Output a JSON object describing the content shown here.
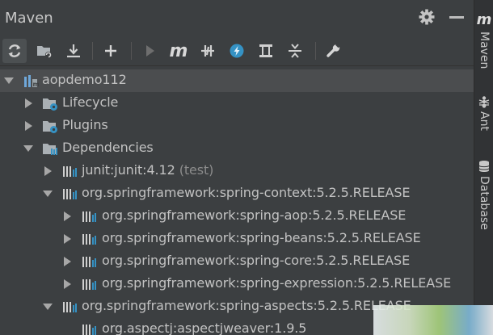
{
  "panel": {
    "title": "Maven"
  },
  "toolbar": {
    "buttons": [
      {
        "name": "refresh"
      },
      {
        "name": "reimport-folder"
      },
      {
        "name": "download-sources"
      },
      {
        "name": "add"
      },
      {
        "name": "run"
      },
      {
        "name": "execute-goal"
      },
      {
        "name": "toggle-offline"
      },
      {
        "name": "skip-tests"
      },
      {
        "name": "show-dependencies"
      },
      {
        "name": "collapse-all"
      },
      {
        "name": "settings-wrench"
      }
    ],
    "execute_goal_glyph": "m"
  },
  "tree": {
    "rows": [
      {
        "label": "aopdemo112",
        "suffix": ""
      },
      {
        "label": "Lifecycle",
        "suffix": ""
      },
      {
        "label": "Plugins",
        "suffix": ""
      },
      {
        "label": "Dependencies",
        "suffix": ""
      },
      {
        "label": "junit:junit:4.12",
        "suffix": " (test)"
      },
      {
        "label": "org.springframework:spring-context:5.2.5.RELEASE",
        "suffix": ""
      },
      {
        "label": "org.springframework:spring-aop:5.2.5.RELEASE",
        "suffix": ""
      },
      {
        "label": "org.springframework:spring-beans:5.2.5.RELEASE",
        "suffix": ""
      },
      {
        "label": "org.springframework:spring-core:5.2.5.RELEASE",
        "suffix": ""
      },
      {
        "label": "org.springframework:spring-expression:5.2.5.RELEASE",
        "suffix": ""
      },
      {
        "label": "org.springframework:spring-aspects:5.2.5.RELEASE",
        "suffix": ""
      },
      {
        "label": "org.aspectj:aspectjweaver:1.9.5",
        "suffix": ""
      }
    ]
  },
  "sidebar": {
    "tabs": [
      {
        "glyph": "m",
        "label": "Maven"
      },
      {
        "label": "Ant"
      },
      {
        "label": "Database"
      }
    ]
  },
  "colors": {
    "background": "#3c3f41",
    "selection": "#4b4d4f",
    "text": "#c2c2c2",
    "muted": "#8c8c8c",
    "accent_blue": "#3592c4",
    "folder_blue": "#6fa7d9"
  }
}
